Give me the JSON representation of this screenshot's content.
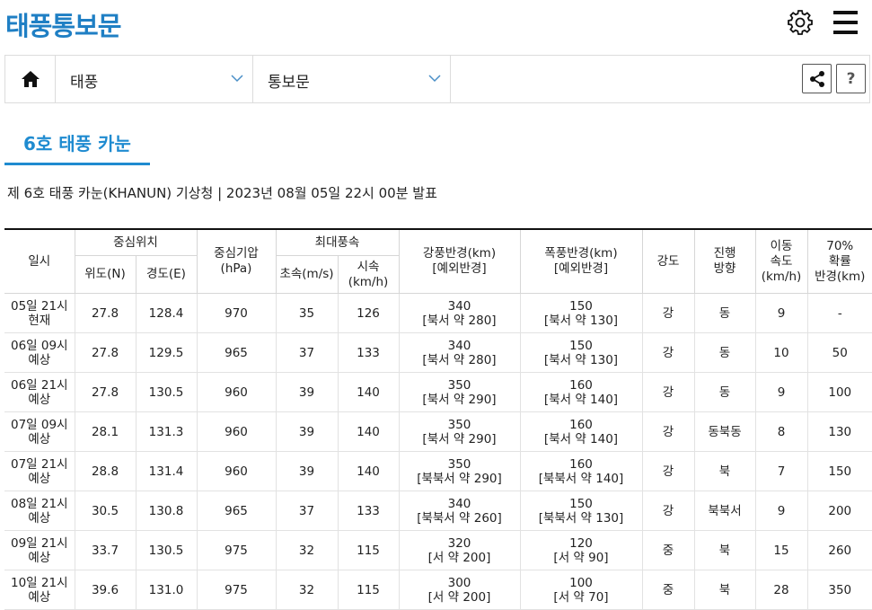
{
  "app": {
    "title": "태풍통보문"
  },
  "nav": {
    "select1": "태풍",
    "select2": "통보문",
    "help_label": "?"
  },
  "tab": {
    "label": "6호 태풍 카눈"
  },
  "bulletin": {
    "text": "제 6호 태풍 카눈(KHANUN) 기상청 | 2023년 08월 05일 22시 00분 발표"
  },
  "table": {
    "headers": {
      "datetime": "일시",
      "center_position": "중심위치",
      "lat": "위도(N)",
      "lon": "경도(E)",
      "pressure_l1": "중심기압",
      "pressure_l2": "(hPa)",
      "max_wind": "최대풍속",
      "wind_ms": "초속(m/s)",
      "wind_kmh_l1": "시속",
      "wind_kmh_l2": "(km/h)",
      "gale_l1": "강풍반경(km)",
      "gale_l2": "[예외반경]",
      "storm_l1": "폭풍반경(km)",
      "storm_l2": "[예외반경]",
      "intensity": "강도",
      "direction_l1": "진행",
      "direction_l2": "방향",
      "speed_l1": "이동",
      "speed_l2": "속도",
      "speed_l3": "(km/h)",
      "prob_l1": "70%",
      "prob_l2": "확률",
      "prob_l3": "반경(km)"
    },
    "rows": [
      {
        "d1": "05일 21시",
        "d2": "현재",
        "lat": "27.8",
        "lon": "128.4",
        "pres": "970",
        "ms": "35",
        "kmh": "126",
        "gale": "340",
        "gale_ex": "[북서 약 280]",
        "storm": "150",
        "storm_ex": "[북서 약 130]",
        "int": "강",
        "dir": "동",
        "spd": "9",
        "prob": "-"
      },
      {
        "d1": "06일 09시",
        "d2": "예상",
        "lat": "27.8",
        "lon": "129.5",
        "pres": "965",
        "ms": "37",
        "kmh": "133",
        "gale": "340",
        "gale_ex": "[북서 약 280]",
        "storm": "150",
        "storm_ex": "[북서 약 130]",
        "int": "강",
        "dir": "동",
        "spd": "10",
        "prob": "50"
      },
      {
        "d1": "06일 21시",
        "d2": "예상",
        "lat": "27.8",
        "lon": "130.5",
        "pres": "960",
        "ms": "39",
        "kmh": "140",
        "gale": "350",
        "gale_ex": "[북서 약 290]",
        "storm": "160",
        "storm_ex": "[북서 약 140]",
        "int": "강",
        "dir": "동",
        "spd": "9",
        "prob": "100"
      },
      {
        "d1": "07일 09시",
        "d2": "예상",
        "lat": "28.1",
        "lon": "131.3",
        "pres": "960",
        "ms": "39",
        "kmh": "140",
        "gale": "350",
        "gale_ex": "[북서 약 290]",
        "storm": "160",
        "storm_ex": "[북서 약 140]",
        "int": "강",
        "dir": "동북동",
        "spd": "8",
        "prob": "130"
      },
      {
        "d1": "07일 21시",
        "d2": "예상",
        "lat": "28.8",
        "lon": "131.4",
        "pres": "960",
        "ms": "39",
        "kmh": "140",
        "gale": "350",
        "gale_ex": "[북북서 약 290]",
        "storm": "160",
        "storm_ex": "[북북서 약 140]",
        "int": "강",
        "dir": "북",
        "spd": "7",
        "prob": "150"
      },
      {
        "d1": "08일 21시",
        "d2": "예상",
        "lat": "30.5",
        "lon": "130.8",
        "pres": "965",
        "ms": "37",
        "kmh": "133",
        "gale": "340",
        "gale_ex": "[북북서 약 260]",
        "storm": "150",
        "storm_ex": "[북북서 약 130]",
        "int": "강",
        "dir": "북북서",
        "spd": "9",
        "prob": "200"
      },
      {
        "d1": "09일 21시",
        "d2": "예상",
        "lat": "33.7",
        "lon": "130.5",
        "pres": "975",
        "ms": "32",
        "kmh": "115",
        "gale": "320",
        "gale_ex": "[서 약 200]",
        "storm": "120",
        "storm_ex": "[서 약 90]",
        "int": "중",
        "dir": "북",
        "spd": "15",
        "prob": "260"
      },
      {
        "d1": "10일 21시",
        "d2": "예상",
        "lat": "39.6",
        "lon": "131.0",
        "pres": "975",
        "ms": "32",
        "kmh": "115",
        "gale": "300",
        "gale_ex": "[서 약 200]",
        "storm": "100",
        "storm_ex": "[서 약 70]",
        "int": "중",
        "dir": "북",
        "spd": "28",
        "prob": "350"
      }
    ]
  }
}
